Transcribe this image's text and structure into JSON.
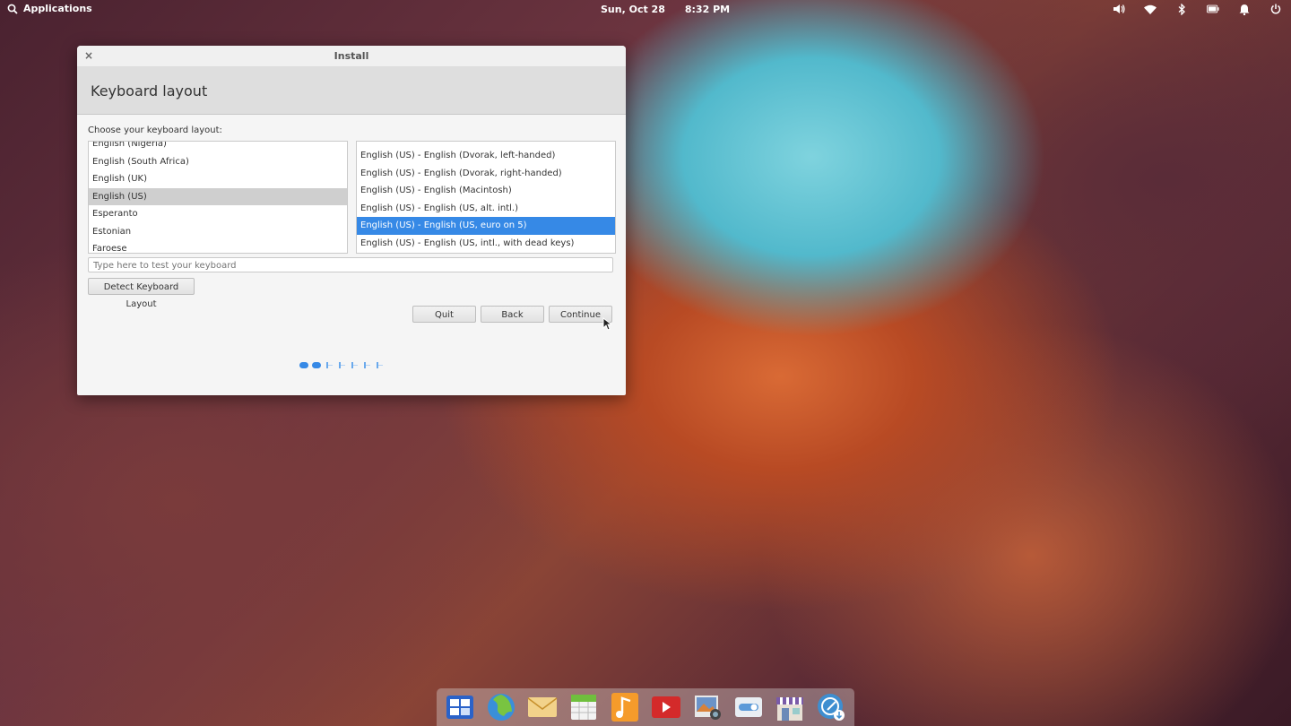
{
  "panel": {
    "applications_label": "Applications",
    "date": "Sun, Oct 28",
    "time": "8:32 PM",
    "indicators": [
      "volume-icon",
      "wifi-icon",
      "bluetooth-icon",
      "battery-icon",
      "notifications-icon",
      "power-icon"
    ]
  },
  "window": {
    "title": "Install",
    "close_glyph": "×",
    "heading": "Keyboard layout",
    "prompt": "Choose your keyboard layout:",
    "layouts": [
      "English (Nigeria)",
      "English (South Africa)",
      "English (UK)",
      "English (US)",
      "Esperanto",
      "Estonian",
      "Faroese"
    ],
    "selected_layout": "English (US)",
    "variants": [
      "English (US) - English (Dvorak, left-handed)",
      "English (US) - English (Dvorak, right-handed)",
      "English (US) - English (Macintosh)",
      "English (US) - English (US, alt. intl.)",
      "English (US) - English (US, euro on 5)",
      "English (US) - English (US, intl., with dead keys)"
    ],
    "selected_variant": "English (US) - English (US, euro on 5)",
    "test_placeholder": "Type here to test your keyboard",
    "detect_button": "Detect Keyboard Layout",
    "quit_button": "Quit",
    "back_button": "Back",
    "continue_button": "Continue",
    "progress": {
      "completed_steps": 2,
      "total_steps": 7
    }
  },
  "dock": {
    "apps": [
      "multitasking-view-icon",
      "web-browser-icon",
      "mail-icon",
      "calendar-icon",
      "music-icon",
      "videos-icon",
      "photos-icon",
      "system-settings-icon",
      "appcenter-icon",
      "installer-icon"
    ]
  },
  "colors": {
    "accent": "#3689e6",
    "panel_text": "#ffffff"
  }
}
